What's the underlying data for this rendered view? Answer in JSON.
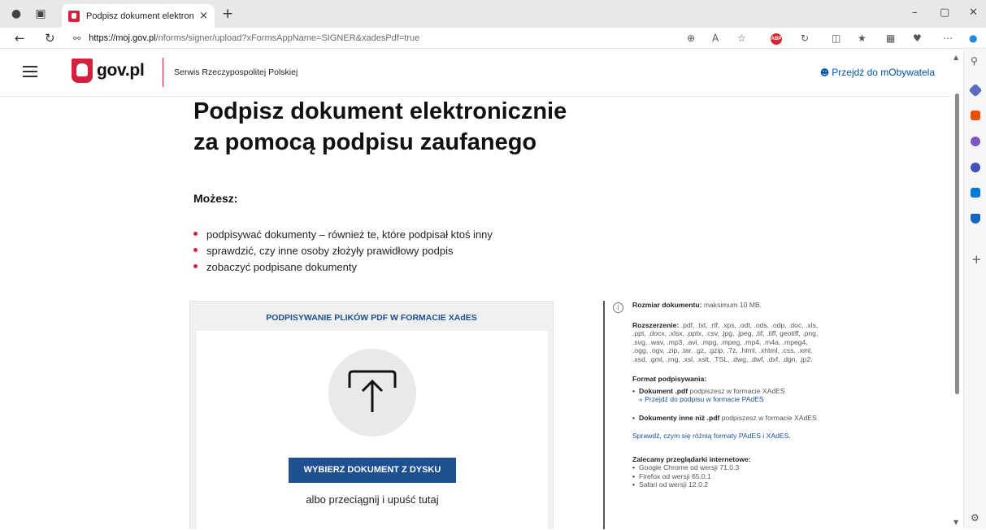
{
  "browser": {
    "tab_title": "Podpisz dokument elektronicznie",
    "tab_close": "×",
    "new_tab": "+",
    "url_host": "https://moj.gov.pl",
    "url_path": "/nforms/signer/upload?xFormsAppName=SIGNER&xadesPdf=true",
    "abp_label": "ABP",
    "win_min": "–",
    "win_max": "▢",
    "win_close": "✕"
  },
  "header": {
    "logo_text": "gov.pl",
    "subtitle": "Serwis Rzeczypospolitej Polskiej",
    "mobywatel_link": "Przejdź do mObywatela"
  },
  "main": {
    "title_line1": "Podpisz dokument elektronicznie",
    "title_line2": "za pomocą podpisu zaufanego",
    "mozesz": "Możesz:",
    "bullets": [
      "podpisywać dokumenty – również te, które podpisał ktoś inny",
      "sprawdzić, czy inne osoby złożyły prawidłowy podpis",
      "zobaczyć podpisane dokumenty"
    ]
  },
  "upload": {
    "heading": "PODPISYWANIE PLIKÓW PDF W FORMACIE XAdES",
    "button": "WYBIERZ DOKUMENT Z DYSKU",
    "drop_text": "albo przeciągnij i upuść tutaj"
  },
  "info": {
    "icon": "i",
    "size_label": "Rozmiar dokumentu:",
    "size_value": "maksimum 10 MB.",
    "ext_label": "Rozszerzenie:",
    "ext_value": ".pdf, .txt, .rtf, .xps, .odt, .ods, .odp, .doc, .xls, .ppt, .docx, .xlsx, .pptx, .csv, .jpg, .jpeg, .tif, .tiff, geotiff, .png, .svg, .wav, .mp3, .avi, .mpg, .mpeg, .mp4, .m4a, .mpeg4, .ogg, .ogv, .zip, .tar, .gz, .gzip, .7z, .html, .xhtml, .css, .xml, .xsd, .gml, .rng, .xsl, .xslt, .TSL, .dwg, .dwf, .dxf, .dgn, .jp2.",
    "format_title": "Format podpisywania:",
    "format_pdf_label": "Dokument .pdf",
    "format_pdf_text": "podpiszesz w formacie XAdES",
    "format_pdf_link": "« Przejdź do podpisu w formacie PAdES",
    "format_other_label": "Dokumenty inne niż .pdf",
    "format_other_text": "podpiszesz w formacie XAdES",
    "compare_link": "Sprawdź, czym się różnią formaty PAdES i XAdES.",
    "browsers_title": "Zalecamy przeglądarki internetowe:",
    "browsers": [
      "Google Chrome od wersji 71.0.3",
      "Firefox od wersji 65.0.1",
      "Safari od wersji 12.0.2"
    ]
  }
}
